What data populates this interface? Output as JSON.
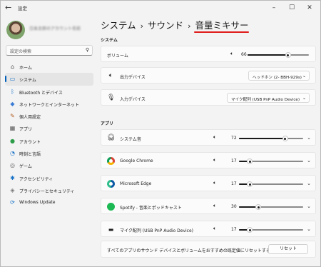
{
  "window": {
    "title": "設定"
  },
  "user": {
    "name": "日本太郎のアカウント名前"
  },
  "search": {
    "placeholder": "設定の検索"
  },
  "sidebar": {
    "items": [
      {
        "label": "ホーム",
        "icon": "home-icon",
        "glyph": "⌂",
        "color": "#444444"
      },
      {
        "label": "システム",
        "icon": "system-icon",
        "glyph": "▭",
        "color": "#1a73c8",
        "active": true
      },
      {
        "label": "Bluetooth とデバイス",
        "icon": "bluetooth-icon",
        "glyph": "ᛒ",
        "color": "#1a73c8"
      },
      {
        "label": "ネットワークとインターネット",
        "icon": "network-icon",
        "glyph": "◆",
        "color": "#3a7bd5"
      },
      {
        "label": "個人用設定",
        "icon": "personalization-icon",
        "glyph": "✎",
        "color": "#b05a1e"
      },
      {
        "label": "アプリ",
        "icon": "apps-icon",
        "glyph": "▦",
        "color": "#555555"
      },
      {
        "label": "アカウント",
        "icon": "account-icon",
        "glyph": "●",
        "color": "#2e9d4a"
      },
      {
        "label": "時刻と言語",
        "icon": "time-language-icon",
        "glyph": "◔",
        "color": "#1a73c8"
      },
      {
        "label": "ゲーム",
        "icon": "gaming-icon",
        "glyph": "◎",
        "color": "#666666"
      },
      {
        "label": "アクセシビリティ",
        "icon": "accessibility-icon",
        "glyph": "✱",
        "color": "#1a73c8"
      },
      {
        "label": "プライバシーとセキュリティ",
        "icon": "privacy-icon",
        "glyph": "◈",
        "color": "#777777"
      },
      {
        "label": "Windows Update",
        "icon": "windows-update-icon",
        "glyph": "⟳",
        "color": "#1a73c8"
      }
    ]
  },
  "breadcrumb": {
    "root": "システム",
    "middle": "サウンド",
    "current": "音量ミキサー",
    "separator": "›"
  },
  "system_section": {
    "title": "システム",
    "volume": {
      "label": "ボリューム",
      "value": "66",
      "level": 0.66
    },
    "output": {
      "label": "出力デバイス",
      "value": "ヘッドホン (2- BBH-929s)"
    },
    "input": {
      "label": "入力デバイス",
      "value": "マイク配列 (USB PnP Audio Device)"
    }
  },
  "apps_section": {
    "title": "アプリ",
    "apps": [
      {
        "name": "システム音",
        "volume": "72",
        "level": 0.72,
        "icon": "headphones-icon"
      },
      {
        "name": "Google Chrome",
        "volume": "17",
        "level": 0.17,
        "icon": "chrome-icon"
      },
      {
        "name": "Microsoft Edge",
        "volume": "17",
        "level": 0.17,
        "icon": "edge-icon"
      },
      {
        "name": "Spotify - 音楽とポッドキャスト",
        "volume": "30",
        "level": 0.3,
        "icon": "spotify-icon"
      },
      {
        "name": "マイク配列 (USB PnP Audio Device)",
        "volume": "17",
        "level": 0.17,
        "icon": "microphone-device-icon"
      }
    ]
  },
  "reset": {
    "text": "すべてのアプリのサウンド デバイスとボリュームをおすすめの既定値にリセットする",
    "button": "リセット"
  },
  "colors": {
    "accent": "#005fb8",
    "underline": "#e01a1a"
  }
}
